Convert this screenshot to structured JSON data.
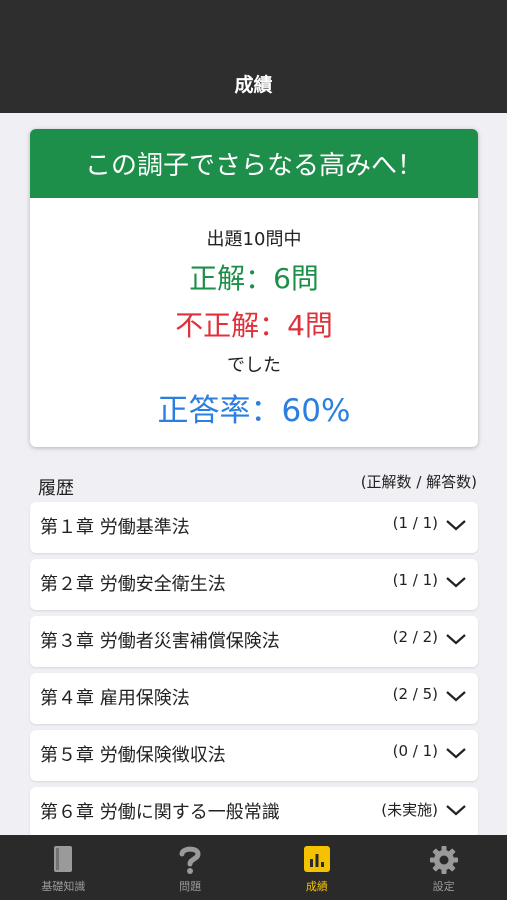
{
  "header": {
    "title": "成績"
  },
  "result": {
    "banner": "この調子でさらなる高みへ！",
    "total": "出題10問中",
    "correct": "正解：6問",
    "wrong": "不正解：4問",
    "deshita": "でした",
    "rate": "正答率：60%"
  },
  "history": {
    "title": "履歴",
    "legend": "(正解数 / 解答数)",
    "chapters": [
      {
        "label": "第１章 労働基準法",
        "score": "(1 / 1)"
      },
      {
        "label": "第２章 労働安全衛生法",
        "score": "(1 / 1)"
      },
      {
        "label": "第３章 労働者災害補償保険法",
        "score": "(2 / 2)"
      },
      {
        "label": "第４章 雇用保険法",
        "score": "(2 / 5)"
      },
      {
        "label": "第５章 労働保険徴収法",
        "score": "(0 / 1)"
      },
      {
        "label": "第６章 労働に関する一般常識",
        "score": "(未実施)"
      }
    ]
  },
  "tabs": [
    {
      "label": "基礎知識",
      "icon": "book-icon",
      "active": false
    },
    {
      "label": "問題",
      "icon": "question-icon",
      "active": false
    },
    {
      "label": "成績",
      "icon": "chart-icon",
      "active": true
    },
    {
      "label": "設定",
      "icon": "gear-icon",
      "active": false
    }
  ],
  "colors": {
    "header_bg": "#2e2e2e",
    "banner_green": "#1e8e4b",
    "correct_green": "#1e8e4b",
    "wrong_red": "#e0303a",
    "rate_blue": "#2b7fe0",
    "tab_active": "#f5c200",
    "tab_inactive": "#9a9a9a"
  }
}
